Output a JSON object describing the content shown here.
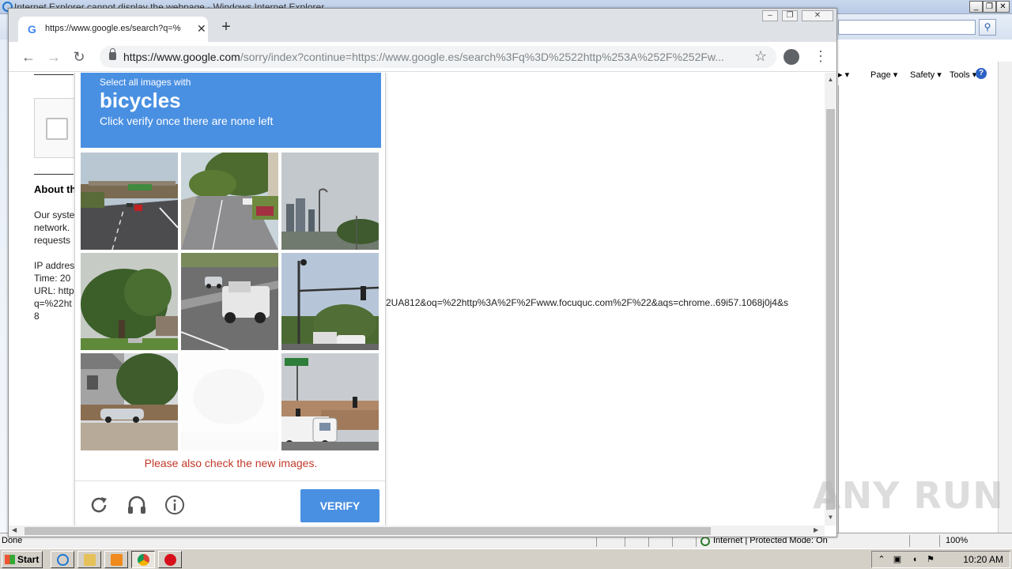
{
  "ie": {
    "title": "Internet Explorer cannot display the webpage - Windows Internet Explorer",
    "commandbar": {
      "page": "Page ▾",
      "safety": "Safety ▾",
      "tools": "Tools ▾"
    },
    "status": {
      "left": "Done",
      "zone": "Internet | Protected Mode: On",
      "zoom": "100%"
    }
  },
  "chrome": {
    "tab_title": "https://www.google.es/search?q=%",
    "url_host": "https://www.google.com",
    "url_rest": "/sorry/index?continue=https://www.google.es/search%3Fq%3D%2522http%253A%252F%252Fw..."
  },
  "sorry_page": {
    "about": "About this page",
    "lines": [
      "Our systems have detected unusual traffic from your computer",
      "network.",
      "requests",
      "",
      "IP address:",
      "Time: 20",
      "URL: http",
      "q=%22ht",
      "8"
    ],
    "url_tail": "2UA812&oq=%22http%3A%2F%2Fwww.focuquc.com%2F%22&aqs=chrome..69i57.1068j0j4&s"
  },
  "captcha": {
    "lead": "Select all images with",
    "object": "bicycles",
    "hint": "Click verify once there are none left",
    "error": "Please also check the new images.",
    "verify_label": "VERIFY",
    "tiles": [
      {
        "id": 1,
        "scene": "highway-overpass"
      },
      {
        "id": 2,
        "scene": "road-trees"
      },
      {
        "id": 3,
        "scene": "towers-sky"
      },
      {
        "id": 4,
        "scene": "large-tree"
      },
      {
        "id": 5,
        "scene": "pickup-truck"
      },
      {
        "id": 6,
        "scene": "traffic-light-pole"
      },
      {
        "id": 7,
        "scene": "house-car"
      },
      {
        "id": 8,
        "scene": "blank-loading"
      },
      {
        "id": 9,
        "scene": "semi-truck-street-sign"
      }
    ]
  },
  "taskbar": {
    "start": "Start",
    "clock": "10:20 AM"
  },
  "watermark": "ANY RUN"
}
